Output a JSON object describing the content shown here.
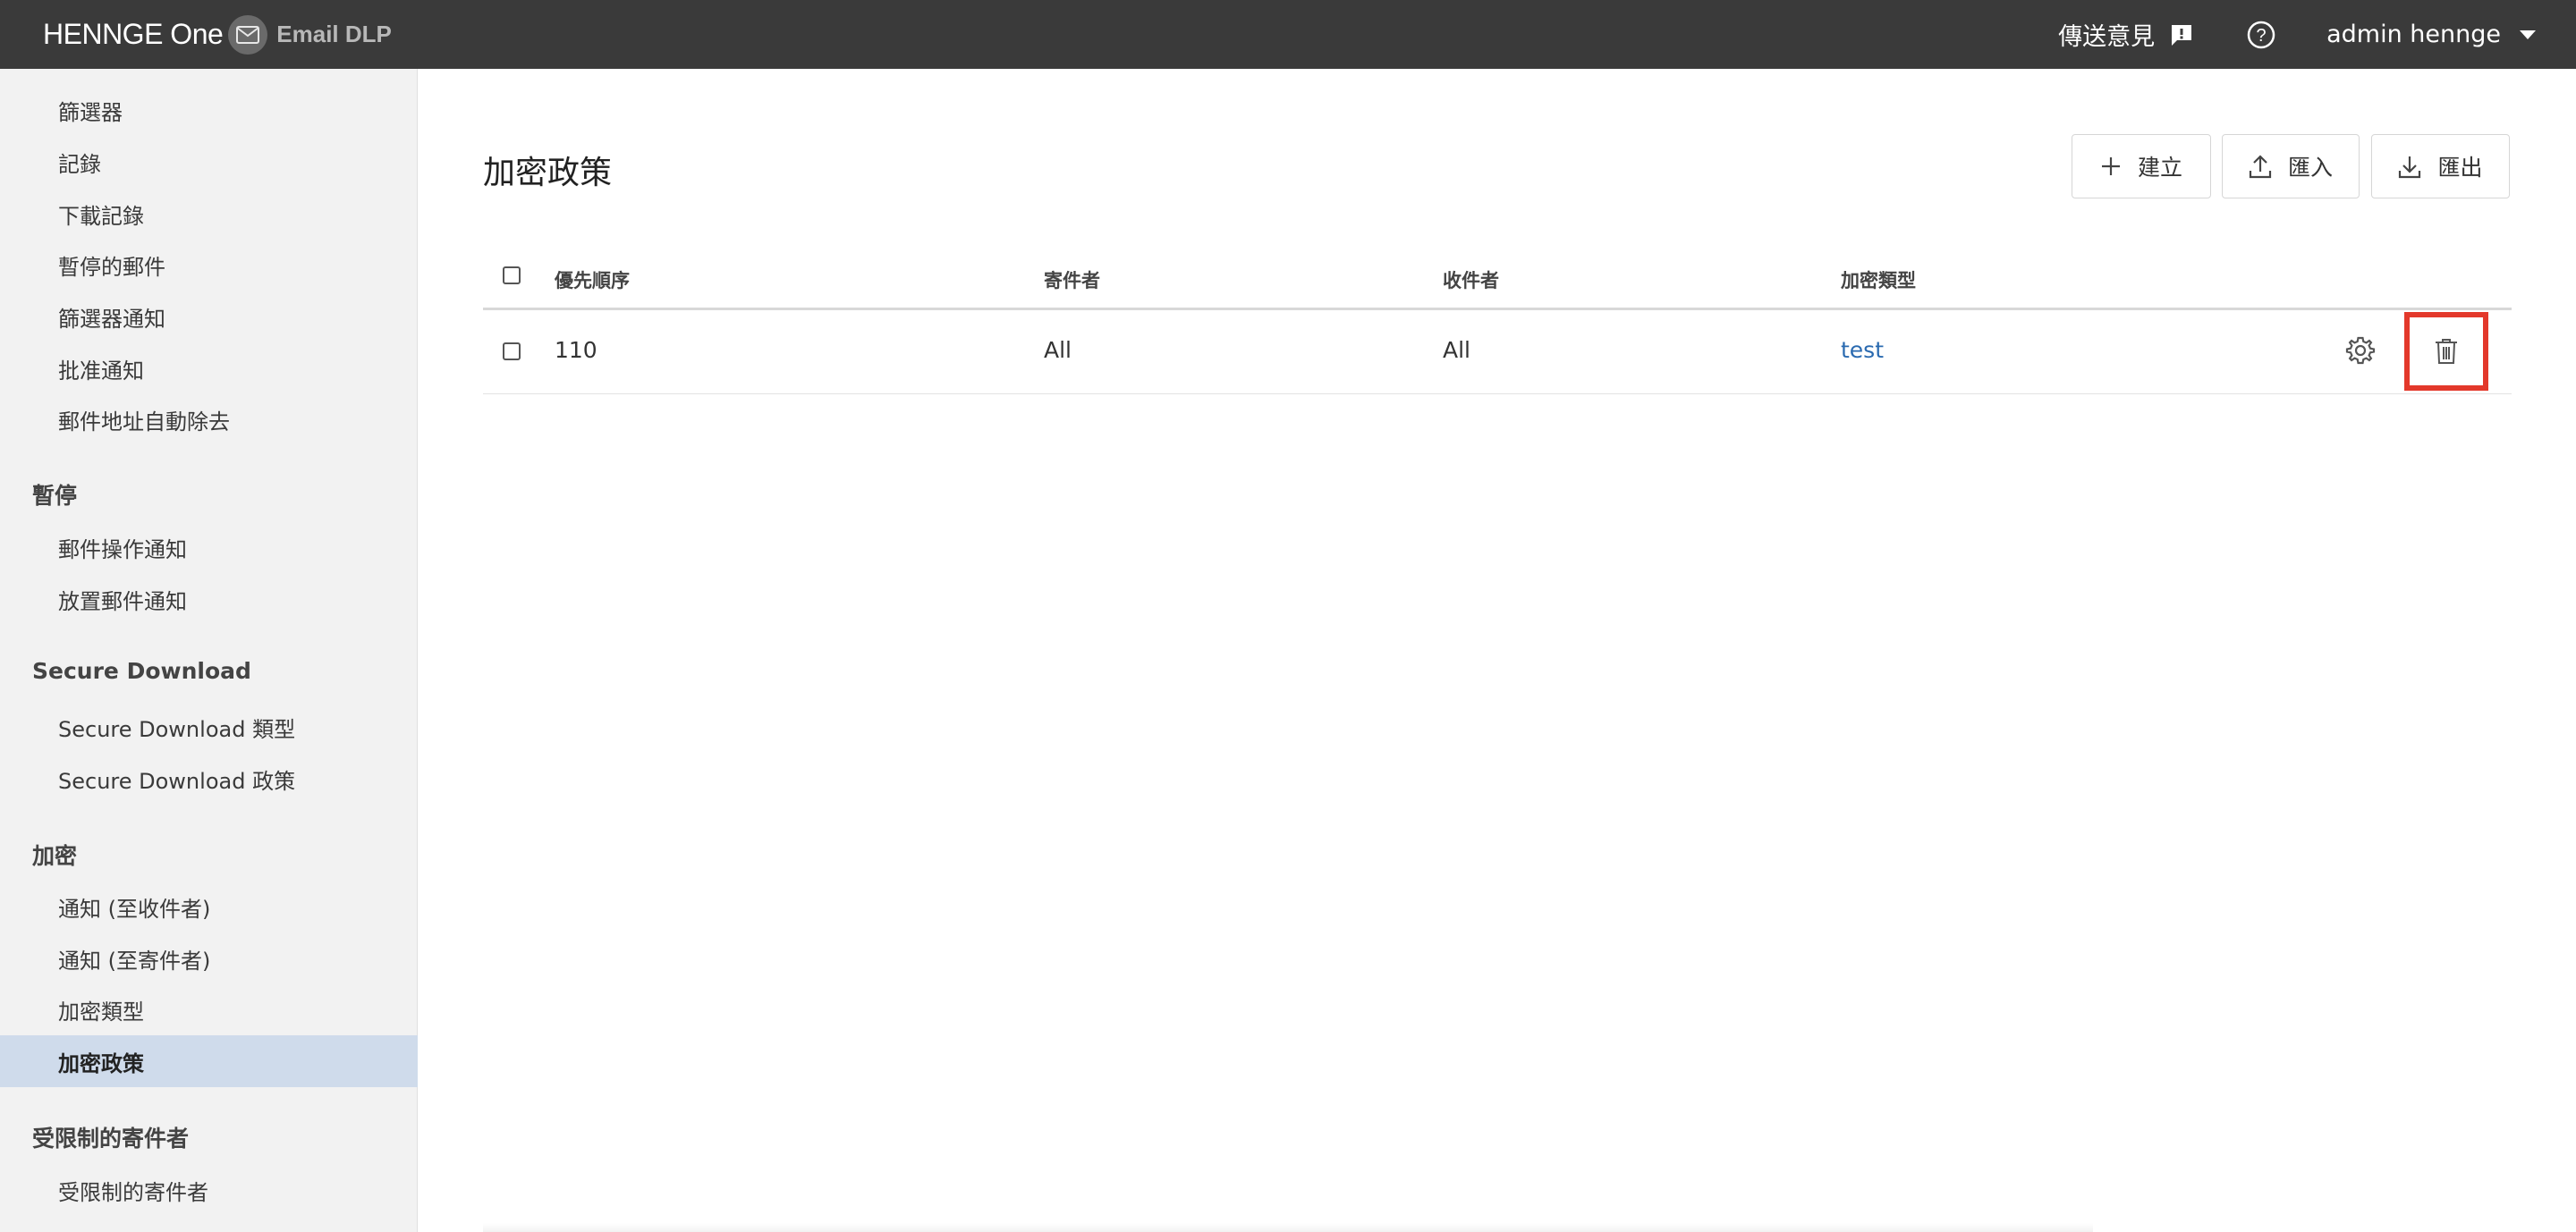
{
  "app": {
    "brand": "HENNGE One",
    "product": "Email DLP"
  },
  "header": {
    "feedback_label": "傳送意見",
    "feedback_icon": "feedback-icon",
    "help_icon": "help-icon",
    "user_name": "admin hennge",
    "user_menu_icon": "caret-down-icon"
  },
  "sidebar": {
    "items_top": [
      "篩選器",
      "記錄",
      "下載記錄",
      "暫停的郵件",
      "篩選器通知",
      "批准通知",
      "郵件地址自動除去"
    ],
    "section_pause": {
      "title": "暫停",
      "items": [
        "郵件操作通知",
        "放置郵件通知"
      ]
    },
    "section_secure": {
      "title": "Secure Download",
      "items": [
        "Secure Download 類型",
        "Secure Download 政策"
      ]
    },
    "section_encrypt": {
      "title": "加密",
      "items": [
        "通知 (至收件者)",
        "通知 (至寄件者)",
        "加密類型",
        "加密政策"
      ],
      "active": "加密政策"
    },
    "section_restricted": {
      "title": "受限制的寄件者",
      "items": [
        "受限制的寄件者"
      ]
    }
  },
  "main": {
    "title": "加密政策",
    "buttons": {
      "create": "建立",
      "import": "匯入",
      "export": "匯出"
    },
    "table": {
      "columns": [
        "優先順序",
        "寄件者",
        "收件者",
        "加密類型"
      ],
      "rows": [
        {
          "priority": "110",
          "sender": "All",
          "recipient": "All",
          "encryption_type": "test"
        }
      ]
    }
  },
  "colors": {
    "topbar": "#3a3a3a",
    "sidebar": "#f2f2f2",
    "active_item": "#cfdbeb",
    "link": "#2a6ab0",
    "highlight": "#e3382b"
  }
}
